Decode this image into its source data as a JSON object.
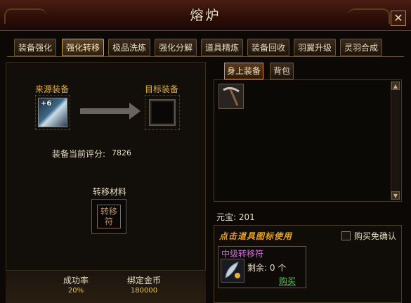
{
  "window": {
    "title": "熔炉",
    "close_label": "✕"
  },
  "tabs": [
    {
      "label": "装备强化",
      "active": false
    },
    {
      "label": "强化转移",
      "active": true
    },
    {
      "label": "极品洗炼",
      "active": false
    },
    {
      "label": "强化分解",
      "active": false
    },
    {
      "label": "道具精炼",
      "active": false
    },
    {
      "label": "装备回收",
      "active": false
    },
    {
      "label": "羽翼升级",
      "active": false
    },
    {
      "label": "灵羽合成",
      "active": false
    }
  ],
  "transfer": {
    "source_label": "来源装备",
    "source_item_level": "+6",
    "target_label": "目标装备",
    "score_label": "装备当前评分:",
    "score_value": "7826",
    "material_title": "转移材料",
    "material_slot_text": "转移符",
    "success_rate_label": "成功率",
    "success_rate_value": "20%",
    "bound_gold_label": "绑定金币",
    "bound_gold_value": "180000"
  },
  "inventory": {
    "tabs": [
      {
        "label": "身上装备",
        "active": true
      },
      {
        "label": "背包",
        "active": false
      }
    ],
    "items": [
      {
        "icon": "pickaxe-icon"
      }
    ]
  },
  "currency": {
    "yuanbao_label": "元宝:",
    "yuanbao_value": "201"
  },
  "shop": {
    "header": "点击道具图标使用",
    "auto_confirm_label": "购买免确认",
    "auto_confirm_checked": false,
    "item": {
      "name": "中级转移符",
      "remain_label": "剩余:",
      "remain_value": "0",
      "remain_unit": "个",
      "buy_label": "购买",
      "icon": "feather-talisman-icon"
    }
  },
  "colors": {
    "gold": "#e8b038",
    "item_purple": "#d070e0",
    "buy_green": "#50d040",
    "title_bg": "#3c130c"
  }
}
